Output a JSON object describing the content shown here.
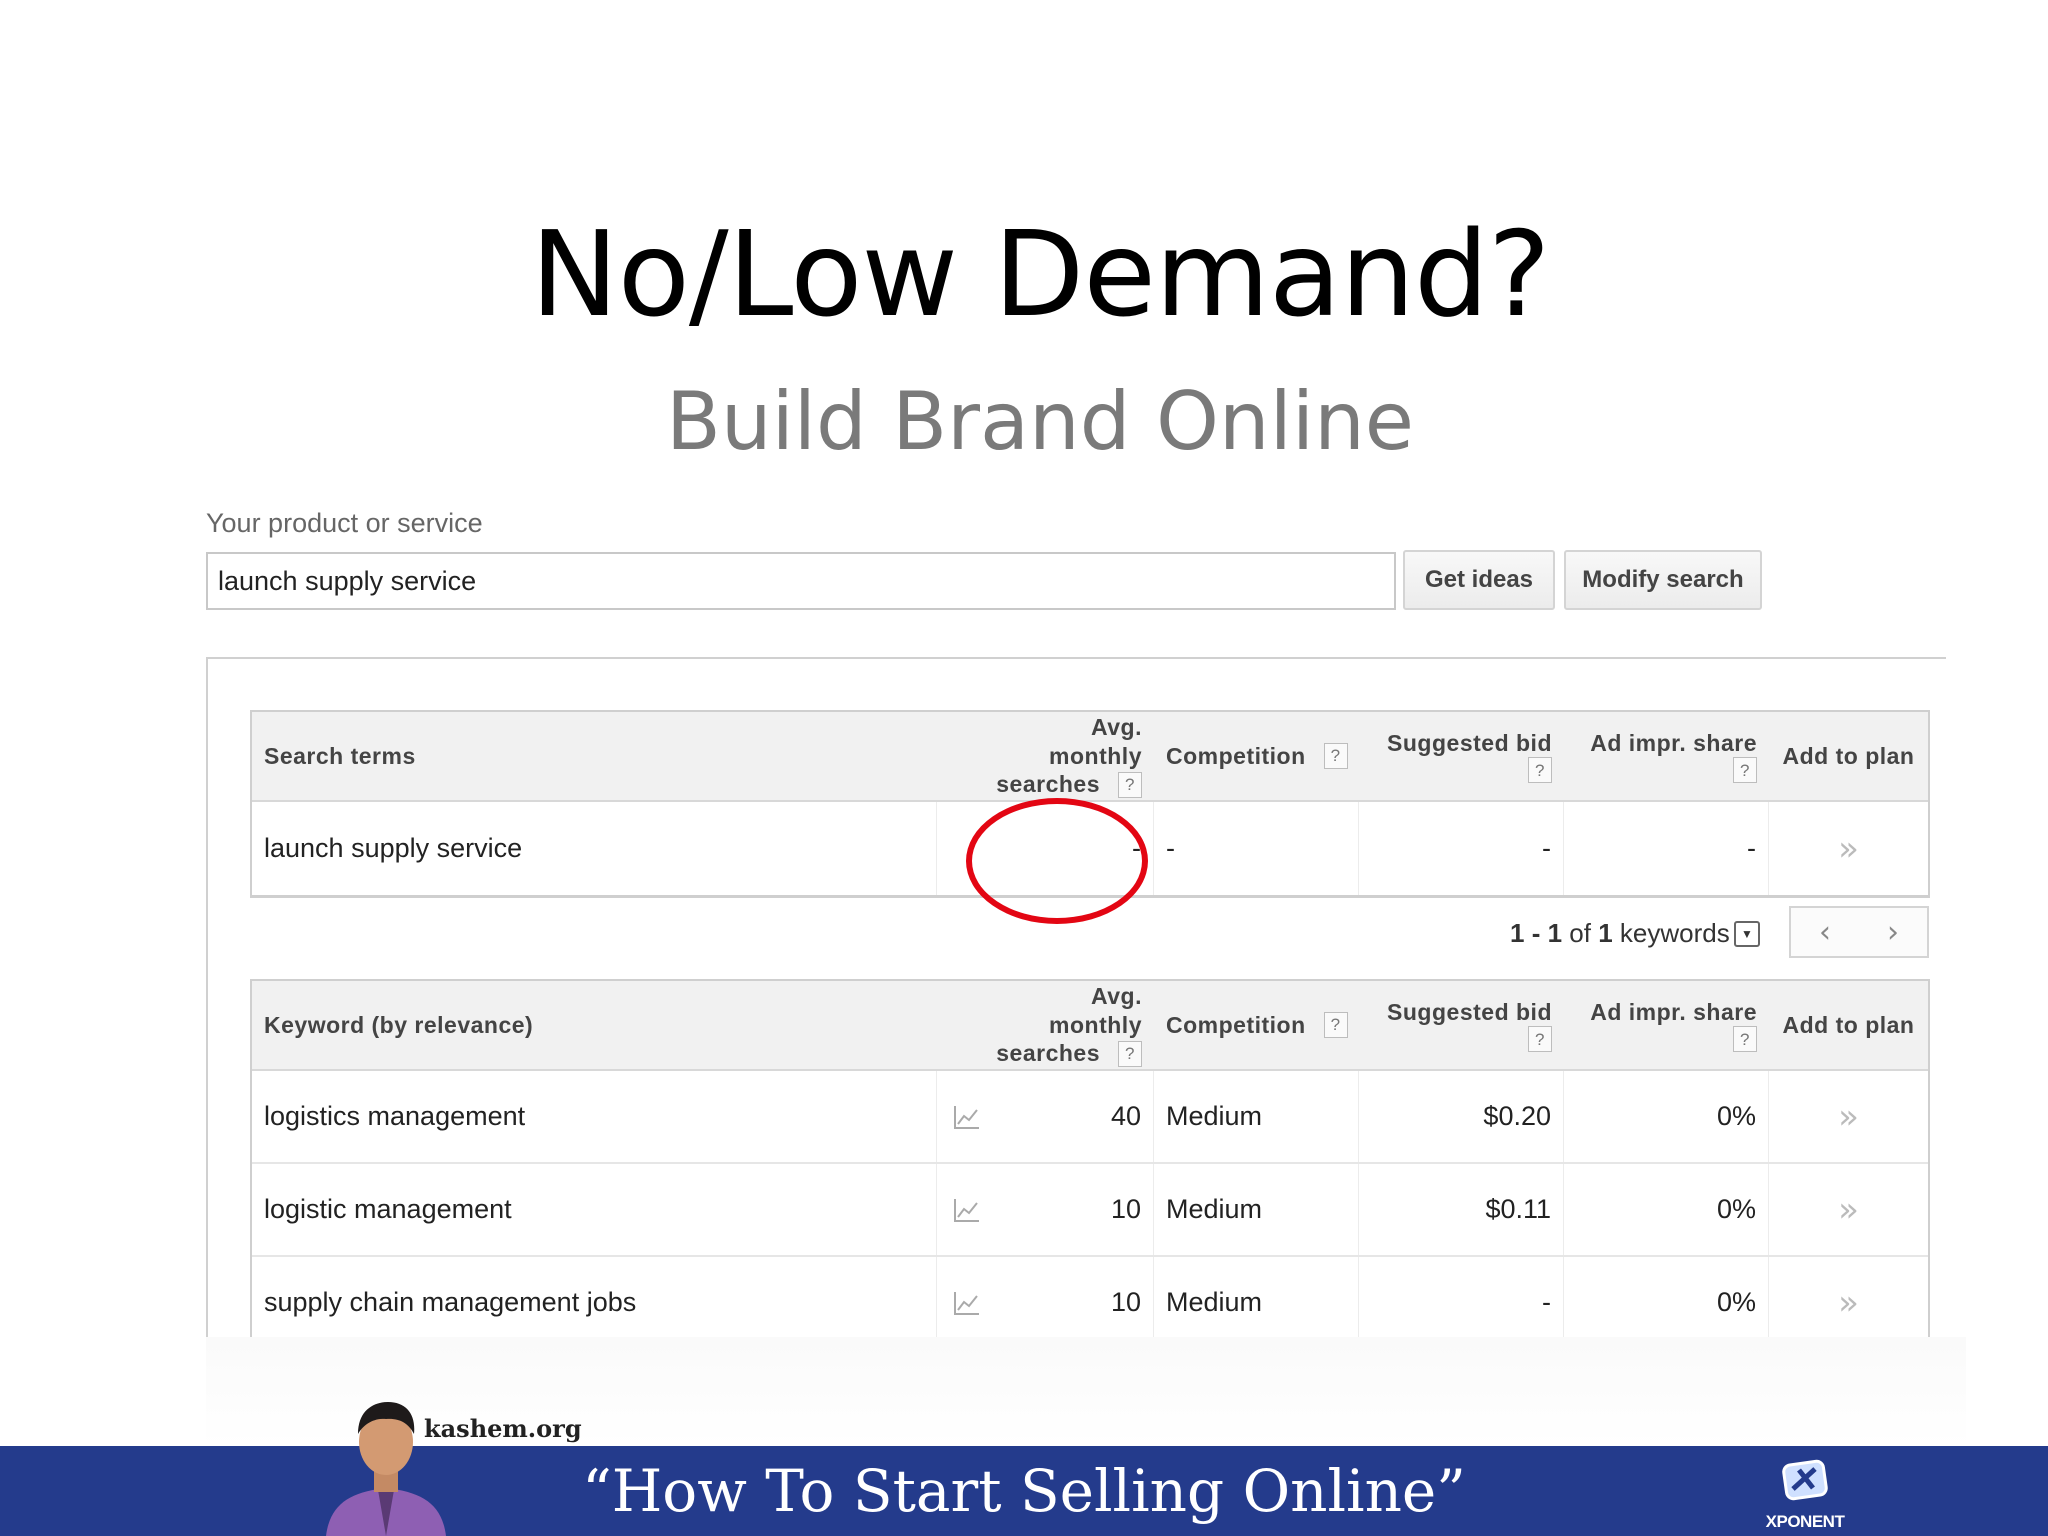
{
  "slide": {
    "title": "No/Low Demand?",
    "subtitle": "Build Brand Online"
  },
  "search": {
    "label": "Your product or service",
    "value": "launch supply service",
    "get_ideas_label": "Get ideas",
    "modify_label": "Modify search"
  },
  "search_terms_table": {
    "headers": {
      "term": "Search terms",
      "avg_line1": "Avg. monthly",
      "avg_line2": "searches",
      "competition": "Competition",
      "bid": "Suggested bid",
      "impr": "Ad impr. share",
      "add": "Add to plan"
    },
    "rows": [
      {
        "term": "launch supply service",
        "avg": "-",
        "competition": "-",
        "bid": "-",
        "impr": "-"
      }
    ]
  },
  "pager": {
    "from": "1",
    "dash": " - ",
    "to": "1",
    "of": " of ",
    "total": "1",
    "suffix": " keywords"
  },
  "keywords_table": {
    "headers": {
      "term": "Keyword (by relevance)",
      "avg_line1": "Avg. monthly",
      "avg_line2": "searches",
      "competition": "Competition",
      "bid": "Suggested bid",
      "impr": "Ad impr. share",
      "add": "Add to plan"
    },
    "rows": [
      {
        "term": "logistics management",
        "avg": "40",
        "competition": "Medium",
        "bid": "$0.20",
        "impr": "0%"
      },
      {
        "term": "logistic management",
        "avg": "10",
        "competition": "Medium",
        "bid": "$0.11",
        "impr": "0%"
      },
      {
        "term": "supply chain management jobs",
        "avg": "10",
        "competition": "Medium",
        "bid": "-",
        "impr": "0%"
      }
    ]
  },
  "help_mark": "?",
  "add_glyph": "»",
  "footer": {
    "site": "kashem.org",
    "tagline": "“How To Start Selling Online”",
    "brand": "XPONENT"
  },
  "colors": {
    "footer_bar": "#243b8c",
    "highlight_circle": "#e30613"
  }
}
